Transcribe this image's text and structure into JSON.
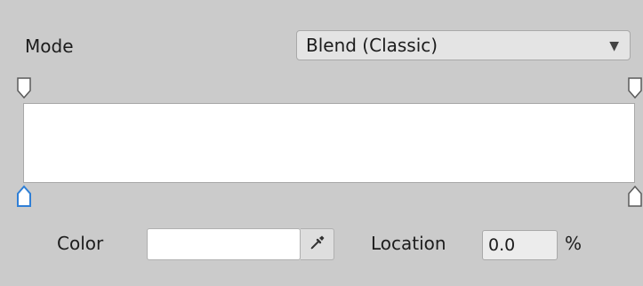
{
  "mode": {
    "label": "Mode",
    "selected": "Blend (Classic)"
  },
  "gradient": {
    "alpha_keys": [
      {
        "location_pct": 0
      },
      {
        "location_pct": 100
      }
    ],
    "color_keys": [
      {
        "location_pct": 0,
        "selected": true
      },
      {
        "location_pct": 100,
        "selected": false
      }
    ],
    "fill_color": "#ffffff"
  },
  "color": {
    "label": "Color",
    "value": "#ffffff",
    "picker_icon": "eyedropper-icon"
  },
  "location": {
    "label": "Location",
    "value": "0.0",
    "unit": "%"
  },
  "colors": {
    "background": "#cbcbcb",
    "selected_marker": "#2f7fd6"
  }
}
